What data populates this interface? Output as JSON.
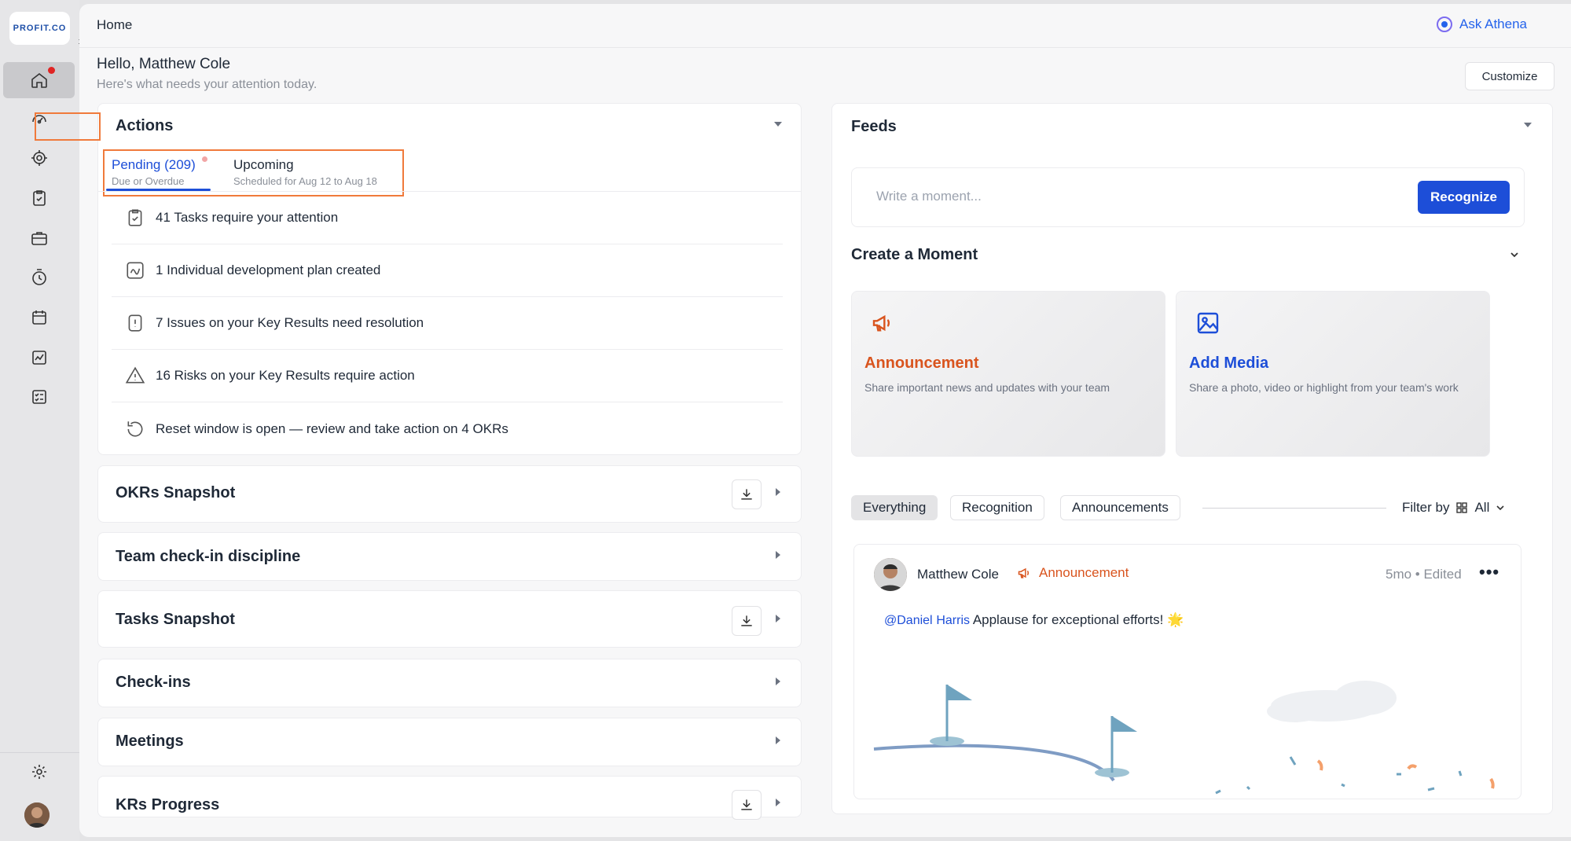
{
  "app": {
    "logo_text": "PROFIT.CO"
  },
  "header": {
    "breadcrumb": "Home",
    "ask_label": "Ask Athena"
  },
  "greeting": {
    "title": "Hello, Matthew Cole",
    "subtitle": "Here's what needs your attention today.",
    "customize_label": "Customize"
  },
  "actions": {
    "title": "Actions",
    "tabs": [
      {
        "label": "Pending (209)",
        "sub": "Due or Overdue"
      },
      {
        "label": "Upcoming",
        "sub": "Scheduled for Aug 12 to Aug 18"
      }
    ],
    "items": [
      {
        "icon": "clipboard-check-icon",
        "text": "41 Tasks require your attention"
      },
      {
        "icon": "chart-line-icon",
        "text": "1 Individual development plan created"
      },
      {
        "icon": "exclamation-icon",
        "text": "7 Issues on your Key Results need resolution"
      },
      {
        "icon": "warning-triangle-icon",
        "text": "16 Risks on your Key Results require action"
      },
      {
        "icon": "reset-icon",
        "text": "Reset window is open — review and take action on 4 OKRs"
      }
    ]
  },
  "sections": [
    {
      "title": "OKRs Snapshot",
      "download": true
    },
    {
      "title": "Team check-in discipline",
      "download": false
    },
    {
      "title": "Tasks Snapshot",
      "download": true
    },
    {
      "title": "Check-ins",
      "download": false
    },
    {
      "title": "Meetings",
      "download": false
    },
    {
      "title": "KRs Progress",
      "download": true
    }
  ],
  "feeds": {
    "title": "Feeds",
    "placeholder": "Write a moment...",
    "recognize_label": "Recognize",
    "create_title": "Create a Moment",
    "cards": [
      {
        "title": "Announcement",
        "desc": "Share important news and updates with your team",
        "color": "#d9541e"
      },
      {
        "title": "Add Media",
        "desc": "Share a photo, video or highlight from your team's work",
        "color": "#1d4ed8"
      }
    ],
    "filters": [
      "Everything",
      "Recognition",
      "Announcements"
    ],
    "filter_by_label": "Filter by",
    "filter_value": "All",
    "post": {
      "author": "Matthew Cole",
      "type": "Announcement",
      "time": "5mo • Edited",
      "more": "•••",
      "mention_first": "@Daniel",
      "mention_last": "Harris",
      "text": "Applause for exceptional efforts! 🌟"
    }
  },
  "colors": {
    "accent": "#1d4ed8",
    "highlight": "#f07a3b",
    "announcement": "#d9541e"
  }
}
